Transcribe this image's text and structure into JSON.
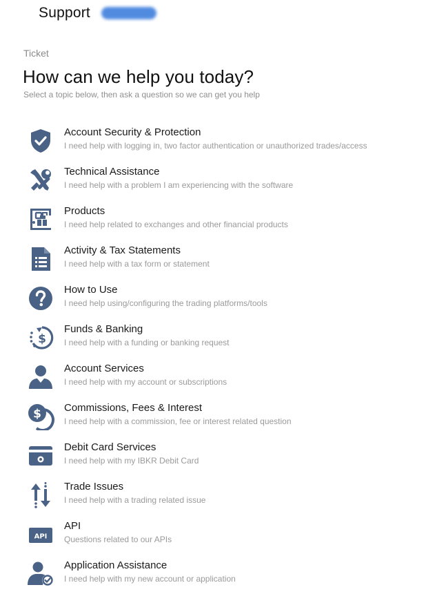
{
  "header": {
    "title": "Support"
  },
  "breadcrumb": "Ticket",
  "page": {
    "title": "How can we help you today?",
    "subtitle": "Select a topic below, then ask a question so we can get you help"
  },
  "colors": {
    "icon": "#4a6285",
    "accent_pill": "#3f7fdd"
  },
  "topics": [
    {
      "name": "Account Security & Protection",
      "description": "I need help with logging in, two factor authentication or unauthorized trades/access",
      "icon": "shield-check-icon"
    },
    {
      "name": "Technical Assistance",
      "description": "I need help with a problem I am experiencing with the software",
      "icon": "tools-icon"
    },
    {
      "name": "Products",
      "description": "I need help related to exchanges and other financial products",
      "icon": "exchange-building-icon"
    },
    {
      "name": "Activity & Tax Statements",
      "description": "I need help with a tax form or statement",
      "icon": "document-list-icon"
    },
    {
      "name": "How to Use",
      "description": "I need help using/configuring the trading platforms/tools",
      "icon": "question-circle-icon"
    },
    {
      "name": "Funds & Banking",
      "description": "I need help with a funding or banking request",
      "icon": "dollar-cycle-icon"
    },
    {
      "name": "Account Services",
      "description": "I need help with my account or subscriptions",
      "icon": "user-icon"
    },
    {
      "name": "Commissions, Fees & Interest",
      "description": "I need help with a commission, fee or interest related question",
      "icon": "coins-icon"
    },
    {
      "name": "Debit Card Services",
      "description": "I need help with my IBKR Debit Card",
      "icon": "debit-card-icon"
    },
    {
      "name": "Trade Issues",
      "description": "I need help with a trading related issue",
      "icon": "trade-arrows-icon"
    },
    {
      "name": "API",
      "description": "Questions related to our APIs",
      "icon": "api-badge-icon",
      "badge": "API"
    },
    {
      "name": "Application Assistance",
      "description": "I need help with my new account or application",
      "icon": "user-check-icon"
    }
  ]
}
